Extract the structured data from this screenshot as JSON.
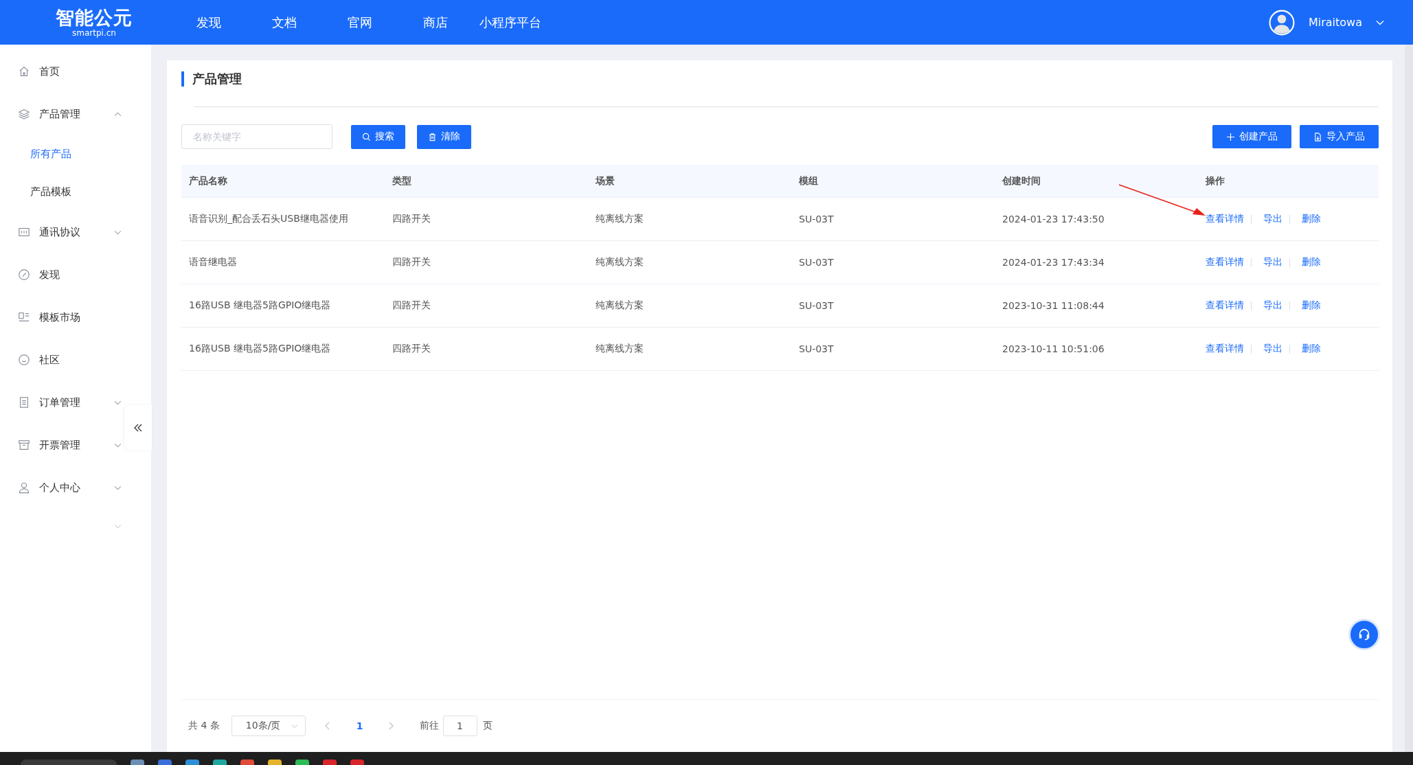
{
  "header": {
    "logo": {
      "name": "智能公元",
      "domain": "smartpi.cn"
    },
    "nav": [
      "发现",
      "文档",
      "官网",
      "商店",
      "小程序平台"
    ],
    "user": {
      "name": "Miraitowa"
    }
  },
  "sidebar": {
    "items": [
      {
        "label": "首页",
        "selected": false
      },
      {
        "label": "产品管理",
        "selected": false,
        "expanded": true,
        "children": [
          {
            "label": "所有产品",
            "selected": true
          },
          {
            "label": "产品模板",
            "selected": false
          }
        ]
      },
      {
        "label": "通讯协议",
        "selected": false,
        "expanded": false
      },
      {
        "label": "发现",
        "selected": false
      },
      {
        "label": "模板市场",
        "selected": false
      },
      {
        "label": "社区",
        "selected": false
      },
      {
        "label": "订单管理",
        "selected": false,
        "expanded": false
      },
      {
        "label": "开票管理",
        "selected": false,
        "expanded": false
      },
      {
        "label": "个人中心",
        "selected": false,
        "expanded": false
      }
    ]
  },
  "page": {
    "title": "产品管理",
    "search": {
      "placeholder": "名称关键字"
    },
    "buttons": [
      {
        "label": "搜索",
        "kind": "search"
      },
      {
        "label": "清除",
        "kind": "clear"
      }
    ],
    "actions": [
      {
        "label": "创建产品",
        "kind": "create"
      },
      {
        "label": "导入产品",
        "kind": "import"
      }
    ],
    "table": {
      "columns": [
        "产品名称",
        "类型",
        "场景",
        "模组",
        "创建时间",
        "操作"
      ],
      "rows": [
        {
          "cells": [
            "语音识别_配合丢石头USB继电器使用",
            "四路开关",
            "纯离线方案",
            "SU-03T",
            "2024-01-23 17:43:50"
          ],
          "actions": [
            "查看详情",
            "导出",
            "删除"
          ]
        },
        {
          "cells": [
            "语音继电器",
            "四路开关",
            "纯离线方案",
            "SU-03T",
            "2024-01-23 17:43:34"
          ],
          "actions": [
            "查看详情",
            "导出",
            "删除"
          ]
        },
        {
          "cells": [
            "16路USB 继电器5路GPIO继电器",
            "四路开关",
            "纯离线方案",
            "SU-03T",
            "2023-10-31 11:08:44"
          ],
          "actions": [
            "查看详情",
            "导出",
            "删除"
          ]
        },
        {
          "cells": [
            "16路USB 继电器5路GPIO继电器",
            "四路开关",
            "纯离线方案",
            "SU-03T",
            "2023-10-11 10:51:06"
          ],
          "actions": [
            "查看详情",
            "导出",
            "删除"
          ]
        }
      ]
    },
    "pagination": {
      "total": "共 4 条",
      "page_size": "10条/页",
      "pages": [
        {
          "label": "1",
          "selected": true
        }
      ],
      "goto_label": "前往",
      "goto_value": "1",
      "goto_suffix": "页"
    }
  }
}
